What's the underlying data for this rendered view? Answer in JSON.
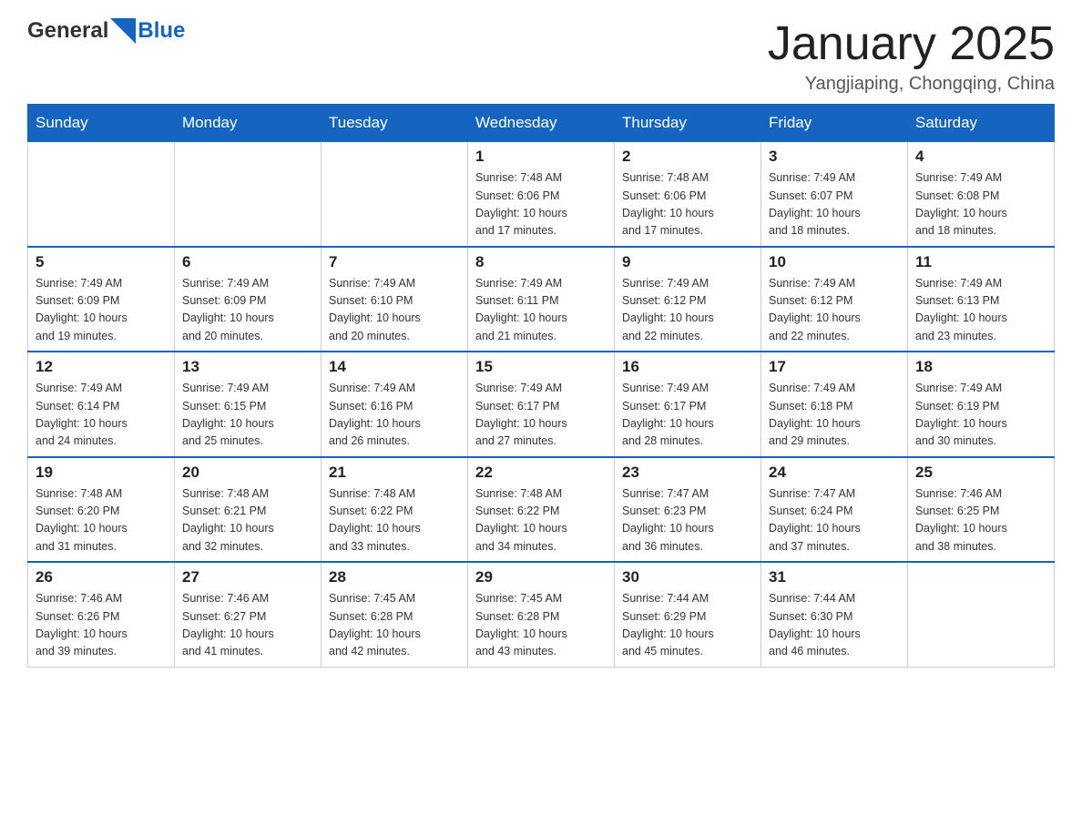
{
  "logo": {
    "general": "General",
    "blue": "Blue"
  },
  "title": "January 2025",
  "location": "Yangjiaping, Chongqing, China",
  "weekdays": [
    "Sunday",
    "Monday",
    "Tuesday",
    "Wednesday",
    "Thursday",
    "Friday",
    "Saturday"
  ],
  "weeks": [
    [
      {
        "day": "",
        "info": ""
      },
      {
        "day": "",
        "info": ""
      },
      {
        "day": "",
        "info": ""
      },
      {
        "day": "1",
        "info": "Sunrise: 7:48 AM\nSunset: 6:06 PM\nDaylight: 10 hours\nand 17 minutes."
      },
      {
        "day": "2",
        "info": "Sunrise: 7:48 AM\nSunset: 6:06 PM\nDaylight: 10 hours\nand 17 minutes."
      },
      {
        "day": "3",
        "info": "Sunrise: 7:49 AM\nSunset: 6:07 PM\nDaylight: 10 hours\nand 18 minutes."
      },
      {
        "day": "4",
        "info": "Sunrise: 7:49 AM\nSunset: 6:08 PM\nDaylight: 10 hours\nand 18 minutes."
      }
    ],
    [
      {
        "day": "5",
        "info": "Sunrise: 7:49 AM\nSunset: 6:09 PM\nDaylight: 10 hours\nand 19 minutes."
      },
      {
        "day": "6",
        "info": "Sunrise: 7:49 AM\nSunset: 6:09 PM\nDaylight: 10 hours\nand 20 minutes."
      },
      {
        "day": "7",
        "info": "Sunrise: 7:49 AM\nSunset: 6:10 PM\nDaylight: 10 hours\nand 20 minutes."
      },
      {
        "day": "8",
        "info": "Sunrise: 7:49 AM\nSunset: 6:11 PM\nDaylight: 10 hours\nand 21 minutes."
      },
      {
        "day": "9",
        "info": "Sunrise: 7:49 AM\nSunset: 6:12 PM\nDaylight: 10 hours\nand 22 minutes."
      },
      {
        "day": "10",
        "info": "Sunrise: 7:49 AM\nSunset: 6:12 PM\nDaylight: 10 hours\nand 22 minutes."
      },
      {
        "day": "11",
        "info": "Sunrise: 7:49 AM\nSunset: 6:13 PM\nDaylight: 10 hours\nand 23 minutes."
      }
    ],
    [
      {
        "day": "12",
        "info": "Sunrise: 7:49 AM\nSunset: 6:14 PM\nDaylight: 10 hours\nand 24 minutes."
      },
      {
        "day": "13",
        "info": "Sunrise: 7:49 AM\nSunset: 6:15 PM\nDaylight: 10 hours\nand 25 minutes."
      },
      {
        "day": "14",
        "info": "Sunrise: 7:49 AM\nSunset: 6:16 PM\nDaylight: 10 hours\nand 26 minutes."
      },
      {
        "day": "15",
        "info": "Sunrise: 7:49 AM\nSunset: 6:17 PM\nDaylight: 10 hours\nand 27 minutes."
      },
      {
        "day": "16",
        "info": "Sunrise: 7:49 AM\nSunset: 6:17 PM\nDaylight: 10 hours\nand 28 minutes."
      },
      {
        "day": "17",
        "info": "Sunrise: 7:49 AM\nSunset: 6:18 PM\nDaylight: 10 hours\nand 29 minutes."
      },
      {
        "day": "18",
        "info": "Sunrise: 7:49 AM\nSunset: 6:19 PM\nDaylight: 10 hours\nand 30 minutes."
      }
    ],
    [
      {
        "day": "19",
        "info": "Sunrise: 7:48 AM\nSunset: 6:20 PM\nDaylight: 10 hours\nand 31 minutes."
      },
      {
        "day": "20",
        "info": "Sunrise: 7:48 AM\nSunset: 6:21 PM\nDaylight: 10 hours\nand 32 minutes."
      },
      {
        "day": "21",
        "info": "Sunrise: 7:48 AM\nSunset: 6:22 PM\nDaylight: 10 hours\nand 33 minutes."
      },
      {
        "day": "22",
        "info": "Sunrise: 7:48 AM\nSunset: 6:22 PM\nDaylight: 10 hours\nand 34 minutes."
      },
      {
        "day": "23",
        "info": "Sunrise: 7:47 AM\nSunset: 6:23 PM\nDaylight: 10 hours\nand 36 minutes."
      },
      {
        "day": "24",
        "info": "Sunrise: 7:47 AM\nSunset: 6:24 PM\nDaylight: 10 hours\nand 37 minutes."
      },
      {
        "day": "25",
        "info": "Sunrise: 7:46 AM\nSunset: 6:25 PM\nDaylight: 10 hours\nand 38 minutes."
      }
    ],
    [
      {
        "day": "26",
        "info": "Sunrise: 7:46 AM\nSunset: 6:26 PM\nDaylight: 10 hours\nand 39 minutes."
      },
      {
        "day": "27",
        "info": "Sunrise: 7:46 AM\nSunset: 6:27 PM\nDaylight: 10 hours\nand 41 minutes."
      },
      {
        "day": "28",
        "info": "Sunrise: 7:45 AM\nSunset: 6:28 PM\nDaylight: 10 hours\nand 42 minutes."
      },
      {
        "day": "29",
        "info": "Sunrise: 7:45 AM\nSunset: 6:28 PM\nDaylight: 10 hours\nand 43 minutes."
      },
      {
        "day": "30",
        "info": "Sunrise: 7:44 AM\nSunset: 6:29 PM\nDaylight: 10 hours\nand 45 minutes."
      },
      {
        "day": "31",
        "info": "Sunrise: 7:44 AM\nSunset: 6:30 PM\nDaylight: 10 hours\nand 46 minutes."
      },
      {
        "day": "",
        "info": ""
      }
    ]
  ]
}
